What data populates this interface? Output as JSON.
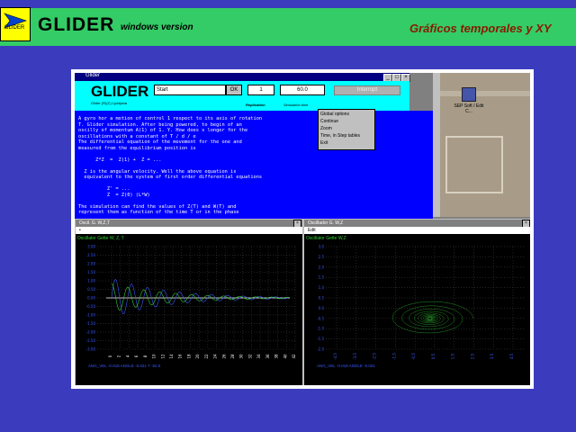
{
  "banner": {
    "logo_text": "GLIDER",
    "title": "GLIDER",
    "subtitle": "windows version",
    "right_title": "Gráficos temporales y XY"
  },
  "app": {
    "window_title": "Glider",
    "logo": "GLIDER",
    "logo_sub": "Glider (R)(C) Ljubljana",
    "name_value": "Start",
    "ok_label": "OK",
    "value1": "1",
    "value2": "60.0",
    "interrupt_label": "Interrupt",
    "label1": "Replication",
    "label2": "Simulation time"
  },
  "desktop": {
    "icon_label": "SEP Soft / Edit C..."
  },
  "text_window": {
    "lines": [
      "A gyro hor a motion of control 1 respect to its axis of rotation",
      "T. Glider simulation. After being powered, to begin of an",
      "oscilly of momentum A(1) of 1. Y. How does s longer for the",
      "oscillations with a constant of T / d / e",
      "The differential equation of the movement for the one and",
      "measured from the equilibrium position is",
      "",
      "      Z*Z  =  Z(1) +  Z = ...",
      "",
      "  Z is the angular velocity. Well the above equation is",
      "  equivalent to the system of first order differential equations",
      "",
      "          Z' = ...",
      "          Z  = Z(0) (L*W)",
      "",
      "The simulation can find the values of Z(T) and W(T) and",
      "represent them as function of the time T or in the phase"
    ]
  },
  "menu": {
    "items": [
      "Global options",
      "Continue",
      "Zoom",
      "Time, in Step tables",
      "Exit"
    ]
  },
  "graph_left": {
    "window_title": "Oscil. G. W,Z,T",
    "menu": "•",
    "label": "Oscillator Gette W, Z, T",
    "y_ticks": [
      "3.00",
      "2.50",
      "2.00",
      "1.50",
      "1.00",
      "0.50",
      "0.00",
      "-0.50",
      "-1.00",
      "-1.50",
      "-2.00",
      "-2.50",
      "-3.00"
    ],
    "x_ticks": [
      "0",
      "2",
      "4",
      "6",
      "8",
      "10",
      "12",
      "14",
      "16",
      "18",
      "20",
      "22",
      "24",
      "26",
      "28",
      "30",
      "32",
      "34",
      "36",
      "38",
      "40",
      "42"
    ],
    "footer": "ANG_VEL  -0.018 ANGLE  -0.021 T  -52.0"
  },
  "graph_right": {
    "window_title": "Oscillador G. W,Z",
    "menu": "Edit",
    "label": "Oscillator Gette W,Z",
    "y_ticks": [
      "3.0",
      "2.5",
      "2.0",
      "1.5",
      "1.0",
      "0.5",
      "0.0",
      "-0.5",
      "-1.0",
      "-1.5",
      "-2.0"
    ],
    "x_ticks": [
      "-4.5",
      "-3.5",
      "-2.5",
      "-1.5",
      "-0.5",
      "0.5",
      "1.5",
      "2.5",
      "3.5",
      "4.5"
    ],
    "footer": "ANG_VEL  -0.018 ANGLE  -0.021"
  },
  "colors": {
    "background": "#3b3bbd",
    "banner": "#33cc66",
    "accent_title": "#8a1a00",
    "text_window": "#0000ff",
    "trace_left": "#3a5aff",
    "trace_right": "#33cc33"
  }
}
